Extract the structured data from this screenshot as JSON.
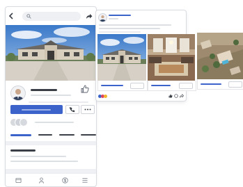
{
  "phone": {
    "nav": {
      "back_icon": "chevron-left-icon",
      "search_icon": "search-icon",
      "share_icon": "share-icon"
    },
    "actions": {
      "call_icon": "phone-icon",
      "more_icon": "ellipsis-icon"
    },
    "tabbar_icons": [
      "home-icon",
      "agent-icon",
      "dollar-icon",
      "menu-icon"
    ]
  },
  "post": {
    "reactions": [
      "like-icon",
      "comment-icon",
      "share-icon"
    ]
  },
  "colors": {
    "accent": "#3b63c9",
    "card_border": "#d9dce1"
  }
}
